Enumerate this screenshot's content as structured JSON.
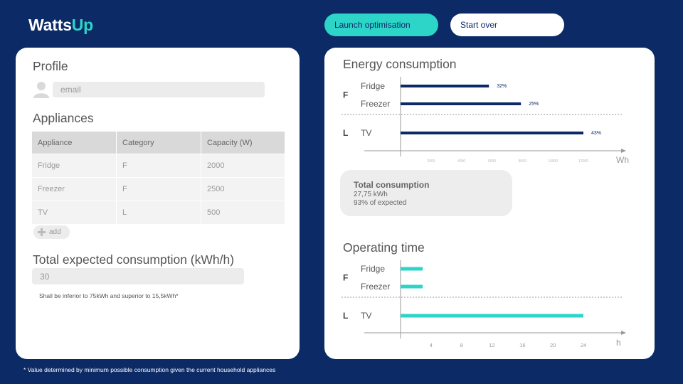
{
  "app": {
    "name_main": "Watts",
    "name_accent": "Up"
  },
  "header": {
    "launch_label": "Launch optimisation",
    "start_over_label": "Start over"
  },
  "profile": {
    "title": "Profile",
    "email_placeholder": "email"
  },
  "appliances": {
    "title": "Appliances",
    "columns": [
      "Appliance",
      "Category",
      "Capacity (W)"
    ],
    "rows": [
      [
        "Fridge",
        "F",
        "2000"
      ],
      [
        "Freezer",
        "F",
        "2500"
      ],
      [
        "TV",
        "L",
        "500"
      ]
    ],
    "add_label": "add"
  },
  "expected": {
    "title": "Total expected consumption (kWh/h)",
    "value": "30",
    "hint": "Shall be inferior to 75kWh and superior  to 15,5kWh*"
  },
  "footnote": "* Value determined by minimum possible consumption given the current household appliances",
  "colors": {
    "background": "#0b2a66",
    "accent": "#2dd4c8",
    "energy_bar": "#0b2a66",
    "time_bar": "#2dd4c8"
  },
  "total_consumption": {
    "title": "Total consumption",
    "value": "27,75 kWh",
    "ratio": "93% of expected"
  },
  "chart_data": [
    {
      "type": "bar",
      "title": "Energy consumption",
      "xlabel": "Wh",
      "xlim": [
        0,
        14000
      ],
      "xticks": [
        2000,
        4000,
        6000,
        8000,
        10000,
        12000
      ],
      "groups": [
        {
          "name": "F",
          "items": [
            {
              "label": "Fridge",
              "value": 5800,
              "data_label": "32%"
            },
            {
              "label": "Freezer",
              "value": 7900,
              "data_label": "25%"
            }
          ]
        },
        {
          "name": "L",
          "items": [
            {
              "label": "TV",
              "value": 12000,
              "data_label": "43%"
            }
          ]
        }
      ]
    },
    {
      "type": "bar",
      "title": "Operating time",
      "xlabel": "h",
      "xlim": [
        0,
        27
      ],
      "xticks": [
        4,
        8,
        12,
        16,
        20,
        24
      ],
      "groups": [
        {
          "name": "F",
          "items": [
            {
              "label": "Fridge",
              "value": 2.9,
              "data_label": ""
            },
            {
              "label": "Freezer",
              "value": 2.9,
              "data_label": ""
            }
          ]
        },
        {
          "name": "L",
          "items": [
            {
              "label": "TV",
              "value": 24,
              "data_label": ""
            }
          ]
        }
      ]
    }
  ]
}
